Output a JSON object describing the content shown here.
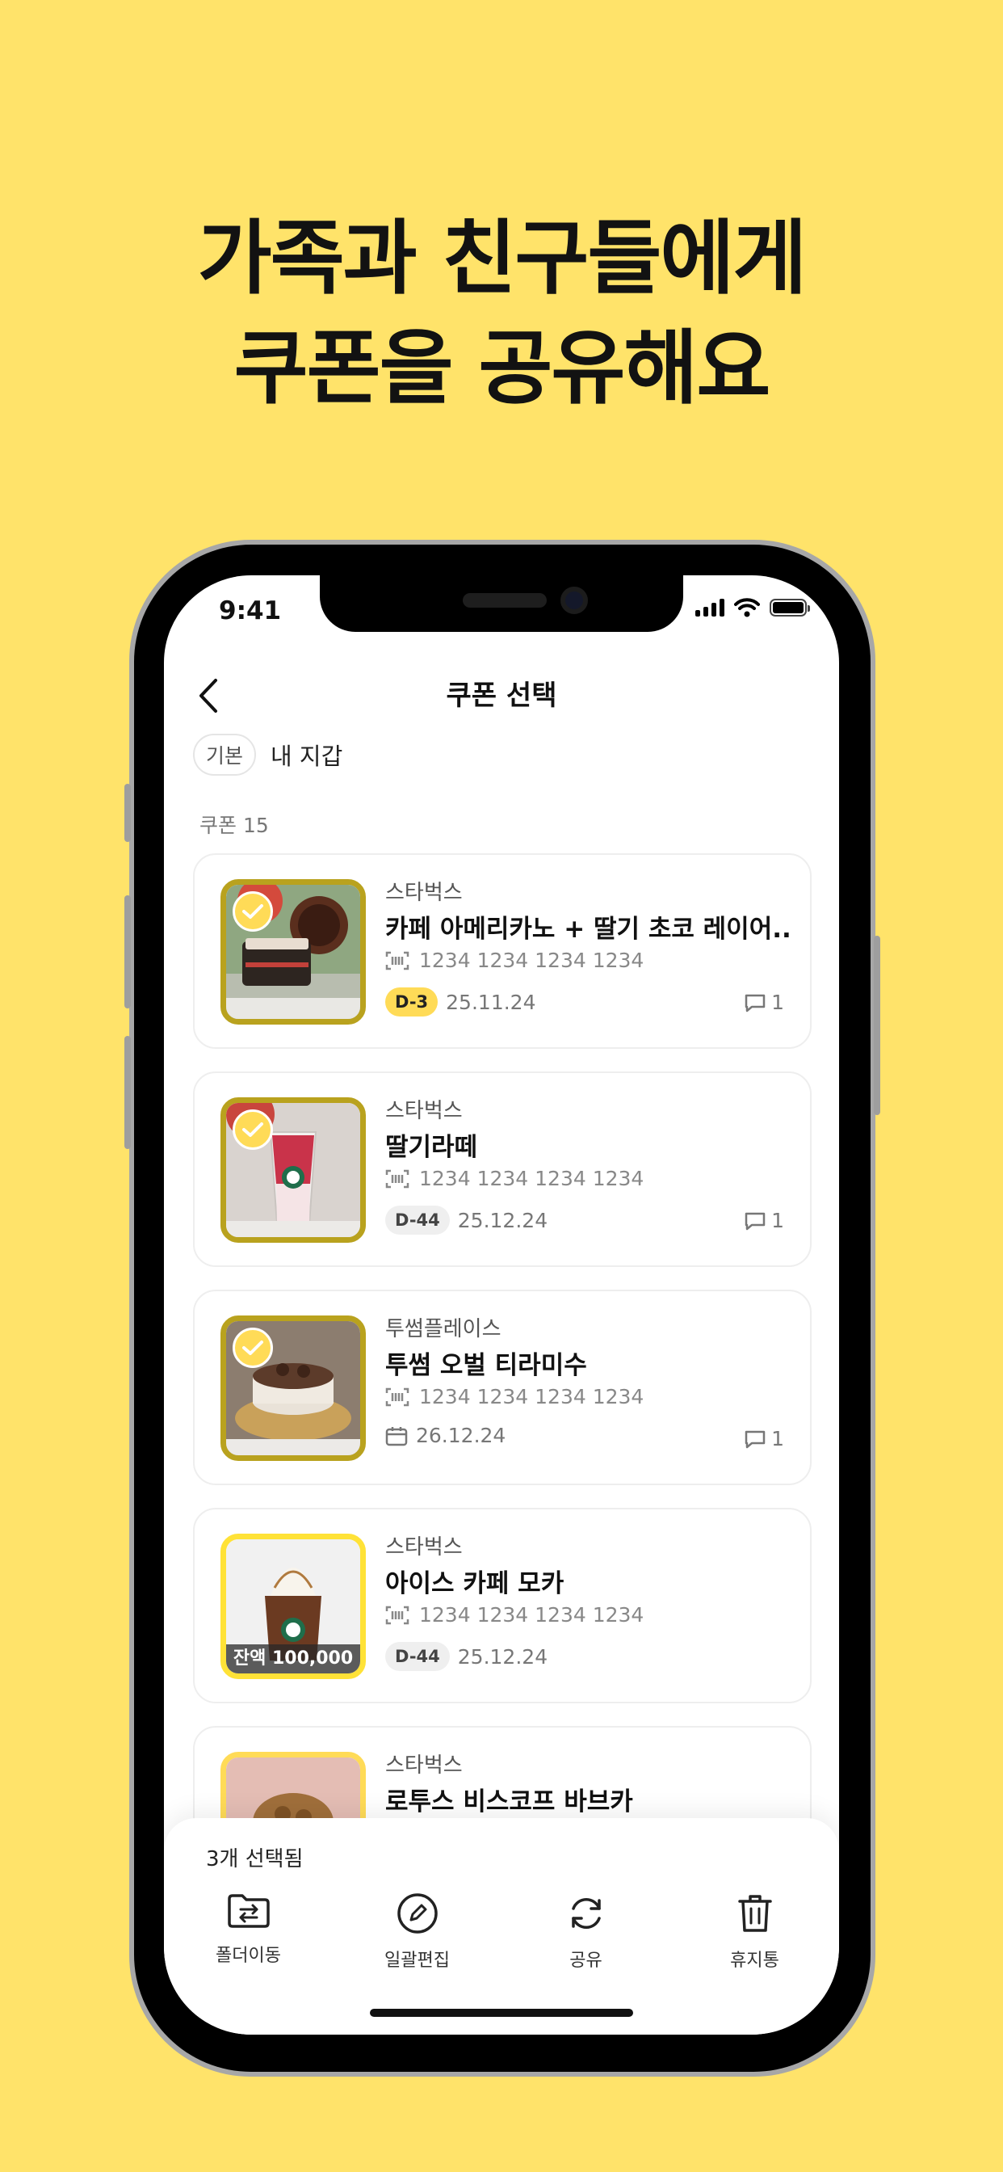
{
  "headline": {
    "line1": "가족과 친구들에게",
    "line2": "쿠폰을 공유해요"
  },
  "colors": {
    "background": "#FFE36A",
    "accent": "#FFDB57"
  },
  "status_bar": {
    "time": "9:41",
    "icons": [
      "signal-icon",
      "wifi-icon",
      "battery-icon"
    ]
  },
  "nav": {
    "back_icon": "chevron-left-icon",
    "title": "쿠폰 선택"
  },
  "wallet": {
    "chip_label": "기본",
    "name": "내 지갑"
  },
  "coupon_count_label": "쿠폰 15",
  "coupons": [
    {
      "brand": "스타벅스",
      "product": "카페 아메리카노 + 딸기 초코 레이어...",
      "barcode": "1234 1234 1234 1234",
      "dday": "D-3",
      "date": "25.11.24",
      "memo_count": "1",
      "selected": true
    },
    {
      "brand": "스타벅스",
      "product": "딸기라떼",
      "barcode": "1234 1234 1234 1234",
      "dday": "D-44",
      "date": "25.12.24",
      "memo_count": "1",
      "selected": true
    },
    {
      "brand": "투썸플레이스",
      "product": "투썸 오벌 티라미수",
      "barcode": "1234 1234 1234 1234",
      "date": "26.12.24",
      "memo_count": "1",
      "selected": true
    },
    {
      "brand": "스타벅스",
      "product": "아이스 카페 모카",
      "barcode": "1234 1234 1234 1234",
      "dday": "D-44",
      "date": "25.12.24",
      "balance": "잔액 100,000",
      "selected": false
    },
    {
      "brand": "스타벅스",
      "product": "로투스 비스코프 바브카",
      "selected": false
    }
  ],
  "bottom_sheet": {
    "selected_text": "3개 선택됨",
    "actions": [
      {
        "icon": "folder-move-icon",
        "label": "폴더이동"
      },
      {
        "icon": "pencil-icon",
        "label": "일괄편집"
      },
      {
        "icon": "refresh-share-icon",
        "label": "공유"
      },
      {
        "icon": "trash-icon",
        "label": "휴지통"
      }
    ]
  }
}
